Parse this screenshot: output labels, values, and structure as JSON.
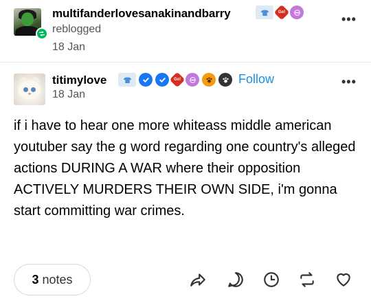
{
  "reblog": {
    "username": "multifanderlovesanakinandbarry",
    "action_text": "reblogged",
    "date": "18 Jan",
    "more_label": "•••",
    "badges": [
      "tshirt-badge",
      "red-badge",
      "brain-badge"
    ]
  },
  "post": {
    "username": "titimylove",
    "follow_label": "Follow",
    "date": "18 Jan",
    "more_label": "•••",
    "badges": [
      "tshirt-badge",
      "blue-check-badge",
      "blue-check-badge",
      "red-badge",
      "brain-badge",
      "orange-paw-badge",
      "dark-paw-badge"
    ],
    "body": "if i have to hear one more whiteass middle american youtuber say the g word regarding one country's alleged actions DURING A WAR where their opposition ACTIVELY MURDERS THEIR OWN SIDE, i'm gonna start committing war crimes."
  },
  "footer": {
    "notes_count": "3",
    "notes_label": "notes",
    "actions": [
      "share-icon",
      "reply-icon",
      "later-icon",
      "reblog-icon",
      "like-icon"
    ]
  },
  "colors": {
    "follow": "#1a8fe6",
    "reblog_green": "#00b85c",
    "text_muted": "#555555"
  }
}
